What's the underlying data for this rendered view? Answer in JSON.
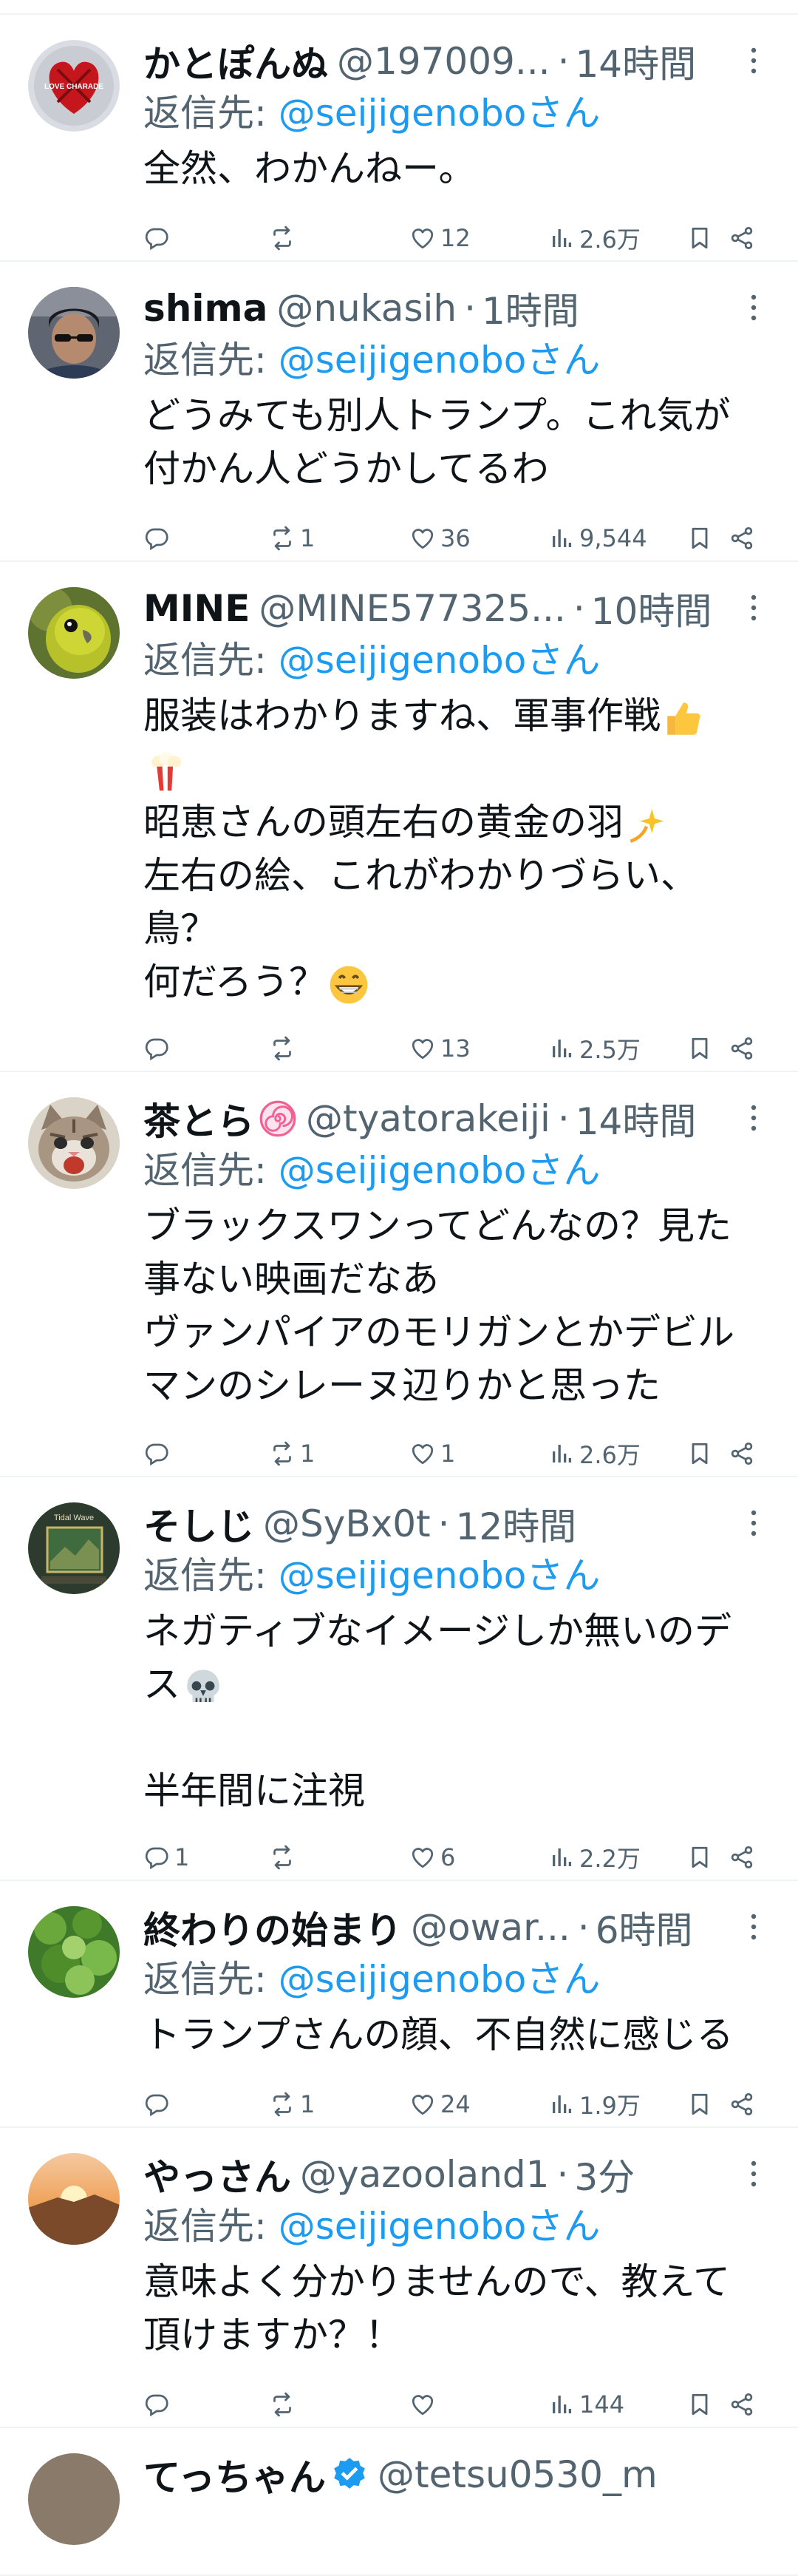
{
  "reply_prefix": "返信先: ",
  "reply_suffix": "さん",
  "dot": "·",
  "tweets": [
    {
      "name": "かとぽんぬ",
      "handle": "@197009...",
      "time": "14時間",
      "reply_to": "@seijigenobo",
      "lines": [
        "全然、わかんねー。"
      ],
      "replies": "",
      "retweets": "",
      "likes": "12",
      "views": "2.6万",
      "avatar": "heart",
      "avatar_text": "LOVE CHARADE"
    },
    {
      "name": "shima",
      "handle": "@nukasih",
      "time": "1時間",
      "reply_to": "@seijigenobo",
      "lines": [
        "どうみても別人トランプ。これ気が",
        "付かん人どうかしてるわ"
      ],
      "replies": "",
      "retweets": "1",
      "likes": "36",
      "views": "9,544",
      "avatar": "person"
    },
    {
      "name": "MINE",
      "handle": "@MINE577325...",
      "time": "10時間",
      "reply_to": "@seijigenobo",
      "lines": [
        "服装はわかりますね、軍事作戦",
        "",
        "昭恵さんの頭左右の黄金の羽",
        "左右の絵、これがわかりづらい、",
        "鳥？",
        "何だろう？"
      ],
      "replies": "",
      "retweets": "",
      "likes": "13",
      "views": "2.5万",
      "avatar": "bird"
    },
    {
      "name": "茶とら",
      "handle": "@tyatorakeiji",
      "time": "14時間",
      "reply_to": "@seijigenobo",
      "lines": [
        "ブラックスワンってどんなの？見た",
        "事ない映画だなあ",
        "ヴァンパイアのモリガンとかデビル",
        "マンのシレーヌ辺りかと思った"
      ],
      "replies": "",
      "retweets": "1",
      "likes": "1",
      "views": "2.6万",
      "avatar": "cat"
    },
    {
      "name": "そしじ",
      "handle": "@SyBx0t",
      "time": "12時間",
      "reply_to": "@seijigenobo",
      "lines": [
        "ネガティブなイメージしか無いのデ",
        "ス",
        "",
        "半年間に注視"
      ],
      "replies": "1",
      "retweets": "",
      "likes": "6",
      "views": "2.2万",
      "avatar": "tidal",
      "avatar_text": "Tidal Wave"
    },
    {
      "name": "終わりの始まり",
      "handle": "@owar...",
      "time": "6時間",
      "reply_to": "@seijigenobo",
      "lines": [
        "トランプさんの顔、不自然に感じる"
      ],
      "replies": "",
      "retweets": "1",
      "likes": "24",
      "views": "1.9万",
      "avatar": "leaves"
    },
    {
      "name": "やっさん",
      "handle": "@yazooland1",
      "time": "3分",
      "reply_to": "@seijigenobo",
      "lines": [
        "意味よく分かりませんので、教えて",
        "頂けますか？！"
      ],
      "replies": "",
      "retweets": "",
      "likes": "",
      "views": "144",
      "avatar": "sunset"
    },
    {
      "name": "てっちゃん",
      "handle": "@tetsu0530_m",
      "time": "",
      "reply_to": "",
      "lines": [],
      "replies": "",
      "retweets": "",
      "likes": "",
      "views": "",
      "avatar": "partial"
    }
  ],
  "colors": {
    "link": "#1d9bf0",
    "muted": "#536471",
    "text": "#0f1419",
    "divider": "#eff3f4",
    "verified": "#1d9bf0"
  }
}
